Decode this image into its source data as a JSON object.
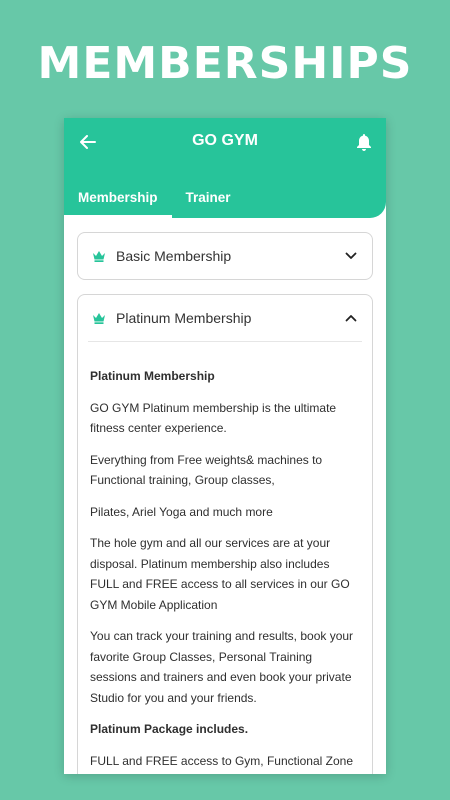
{
  "promo": {
    "title": "MEMBERSHIPS"
  },
  "appbar": {
    "title": "GO GYM"
  },
  "tabs": [
    {
      "label": "Membership"
    },
    {
      "label": "Trainer"
    }
  ],
  "accordions": [
    {
      "title": "Basic Membership",
      "expanded": false
    },
    {
      "title": "Platinum Membership",
      "expanded": true
    }
  ],
  "platinum": {
    "heading": "Platinum Membership",
    "p1": "GO GYM Platinum membership is the ultimate fitness center experience.",
    "p2": "Everything from Free weights& machines to Functional training, Group classes,",
    "p3": "Pilates, Ariel Yoga and much more",
    "p4": "The hole gym and all our services are at your disposal. Platinum membership also includes FULL and FREE access to all services in our GO GYM Mobile Application",
    "p5": "You can track your training and results, book your favorite Group Classes, Personal Training sessions and trainers and even book your private Studio for you and your friends.",
    "package_heading": "Platinum Package includes.",
    "p6": "FULL and FREE access to Gym, Functional Zone"
  },
  "colors": {
    "background": "#67c8a8",
    "appbar": "#27c49a",
    "crown": "#27c49a"
  },
  "icons": {
    "back": "arrow-left-icon",
    "bell": "bell-icon",
    "crown": "crown-icon",
    "chevron_down": "chevron-down-icon",
    "chevron_up": "chevron-up-icon"
  }
}
